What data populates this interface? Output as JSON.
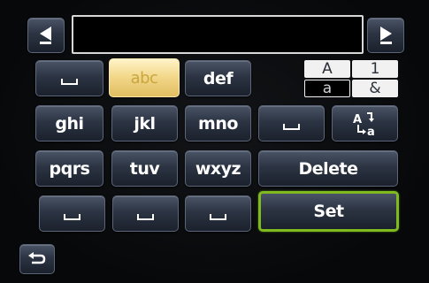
{
  "input": {
    "value": ""
  },
  "nav": {
    "left_icon": "triangle-left-icon",
    "right_icon": "triangle-right-icon",
    "back_icon": "return-arrow-icon"
  },
  "keys": {
    "abc": "abc",
    "def": "def",
    "ghi": "ghi",
    "jkl": "jkl",
    "mno": "mno",
    "pqrs": "pqrs",
    "tuv": "tuv",
    "wxyz": "wxyz",
    "delete": "Delete",
    "set": "Set",
    "space_icon": "space-icon",
    "case_toggle_icon": "case-toggle-icon"
  },
  "modes": {
    "upper": "A",
    "number": "1",
    "lower": "a",
    "symbol": "&"
  },
  "colors": {
    "selected_key": "#f3d98c",
    "set_border": "#7fba1f",
    "key_face": "#2c3443"
  }
}
